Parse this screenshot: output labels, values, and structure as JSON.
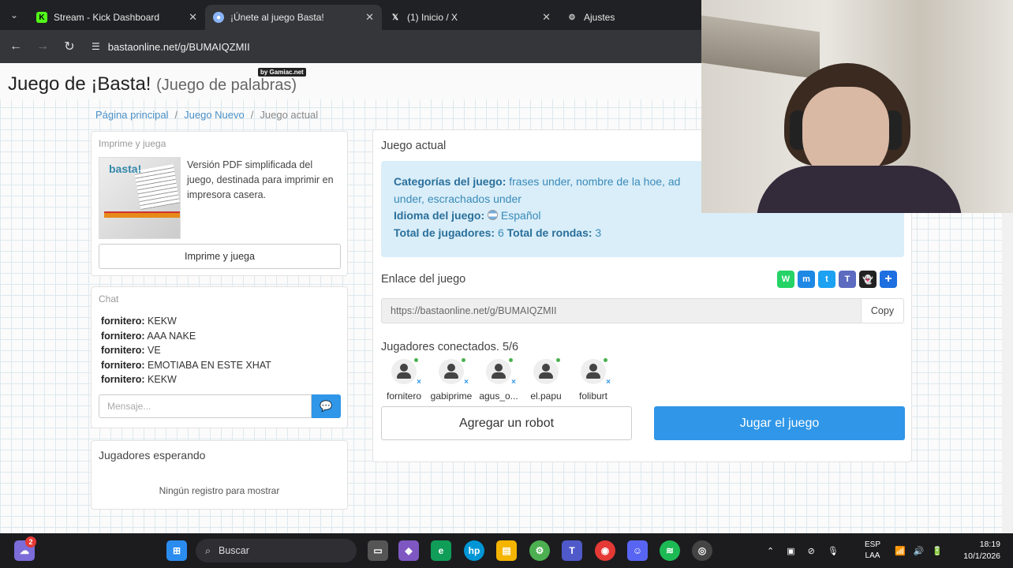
{
  "browser": {
    "tabs": [
      {
        "title": "Stream - Kick Dashboard",
        "icon": "kick-icon",
        "active": false
      },
      {
        "title": "¡Únete al juego Basta!",
        "icon": "basta-icon",
        "active": true
      },
      {
        "title": "(1) Inicio / X",
        "icon": "x-icon",
        "active": false
      },
      {
        "title": "Ajustes",
        "icon": "gear-icon",
        "active": false
      }
    ],
    "url": "bastaonline.net/g/BUMAIQZMII"
  },
  "header": {
    "brand": "Juego de ¡Basta!",
    "brand_sub": "(Juego de palabras)",
    "by": "by Gamiac.net"
  },
  "breadcrumb": {
    "home": "Página principal",
    "new_game": "Juego Nuevo",
    "current": "Juego actual"
  },
  "print_card": {
    "title": "Imprime y juega",
    "description": "Versión PDF simplificada del juego, destinada para imprimir en impresora casera.",
    "button": "Imprime y juega"
  },
  "chat": {
    "title": "Chat",
    "messages": [
      {
        "user": "fornitero:",
        "text": "KEKW"
      },
      {
        "user": "fornitero:",
        "text": "AAA NAKE"
      },
      {
        "user": "fornitero:",
        "text": "VE"
      },
      {
        "user": "fornitero:",
        "text": "EMOTIABA EN ESTE XHAT"
      },
      {
        "user": "fornitero:",
        "text": "KEKW"
      }
    ],
    "placeholder": "Mensaje..."
  },
  "waiting": {
    "title": "Jugadores esperando",
    "empty": "Ningún registro para mostrar"
  },
  "game": {
    "title": "Juego actual",
    "categories_label": "Categorías del juego:",
    "categories_value": "frases under, nombre de la hoe, ad",
    "categories_value_2": "under, escrachados under",
    "language_label": "Idioma del juego:",
    "language_value": "Español",
    "players_label": "Total de jugadores:",
    "players_value": "6",
    "rounds_label": "Total de rondas:",
    "rounds_value": "3",
    "link_label": "Enlace del juego",
    "link_value": "https://bastaonline.net/g/BUMAIQZMII",
    "copy": "Copy",
    "connected_label": "Jugadores conectados. 5/6",
    "players": [
      "fornitero",
      "gabiprime",
      "agus_o...",
      "el.papu",
      "foliburt"
    ],
    "add_robot": "Agregar un robot",
    "play": "Jugar el juego",
    "share_icons": [
      "whatsapp-icon",
      "messenger-icon",
      "twitter-icon",
      "teams-icon",
      "snapchat-icon",
      "share-plus-icon"
    ]
  },
  "taskbar": {
    "search": "Buscar",
    "lang": "ESP",
    "lang2": "LAA",
    "time": "18:19",
    "date": "10/1/2026",
    "badge": "2"
  }
}
